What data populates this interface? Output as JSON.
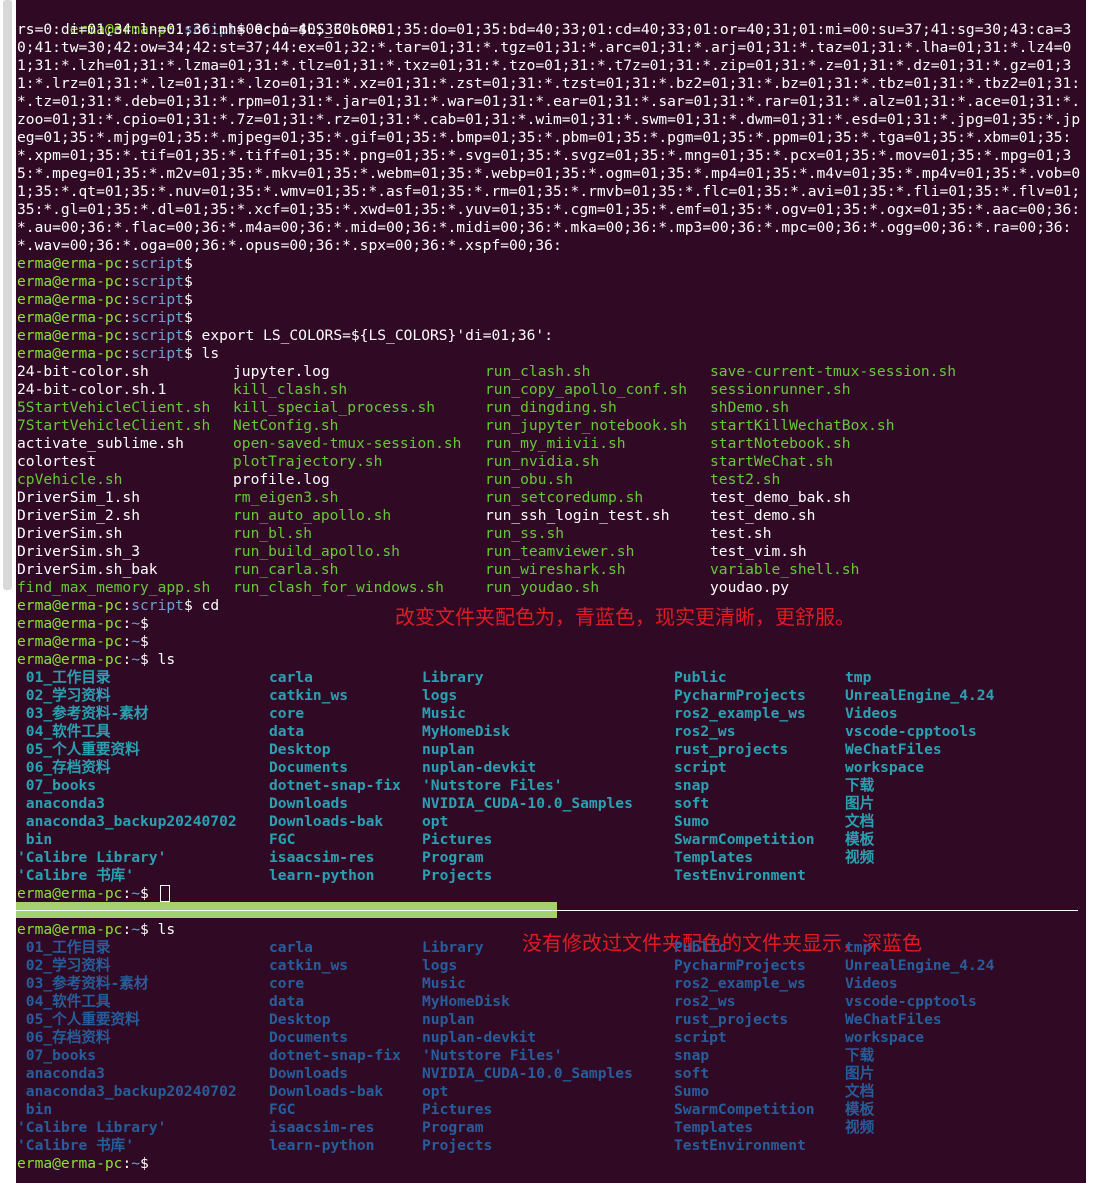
{
  "prompt": {
    "user": "erma@erma-pc",
    "colon": ":",
    "script_dir": "script",
    "home_dir": "~",
    "dollar": "$"
  },
  "commands": {
    "echo": "echo $LS_COLORS",
    "export": "export LS_COLORS=${LS_COLORS}'di=01;36':",
    "ls": "ls",
    "cd": "cd"
  },
  "ls_colors_output": "rs=0:di=01;34:ln=01;36:mh=00:pi=40;33:so=01;35:do=01;35:bd=40;33;01:cd=40;33;01:or=40;31;01:mi=00:su=37;41:sg=30;43:ca=30;41:tw=30;42:ow=34;42:st=37;44:ex=01;32:*.tar=01;31:*.tgz=01;31:*.arc=01;31:*.arj=01;31:*.taz=01;31:*.lha=01;31:*.lz4=01;31:*.lzh=01;31:*.lzma=01;31:*.tlz=01;31:*.txz=01;31:*.tzo=01;31:*.t7z=01;31:*.zip=01;31:*.z=01;31:*.dz=01;31:*.gz=01;31:*.lrz=01;31:*.lz=01;31:*.lzo=01;31:*.xz=01;31:*.zst=01;31:*.tzst=01;31:*.bz2=01;31:*.bz=01;31:*.tbz=01;31:*.tbz2=01;31:*.tz=01;31:*.deb=01;31:*.rpm=01;31:*.jar=01;31:*.war=01;31:*.ear=01;31:*.sar=01;31:*.rar=01;31:*.alz=01;31:*.ace=01;31:*.zoo=01;31:*.cpio=01;31:*.7z=01;31:*.rz=01;31:*.cab=01;31:*.wim=01;31:*.swm=01;31:*.dwm=01;31:*.esd=01;31:*.jpg=01;35:*.jpeg=01;35:*.mjpg=01;35:*.mjpeg=01;35:*.gif=01;35:*.bmp=01;35:*.pbm=01;35:*.pgm=01;35:*.ppm=01;35:*.tga=01;35:*.xbm=01;35:*.xpm=01;35:*.tif=01;35:*.tiff=01;35:*.png=01;35:*.svg=01;35:*.svgz=01;35:*.mng=01;35:*.pcx=01;35:*.mov=01;35:*.mpg=01;35:*.mpeg=01;35:*.m2v=01;35:*.mkv=01;35:*.webm=01;35:*.webp=01;35:*.ogm=01;35:*.mp4=01;35:*.m4v=01;35:*.mp4v=01;35:*.vob=01;35:*.qt=01;35:*.nuv=01;35:*.wmv=01;35:*.asf=01;35:*.rm=01;35:*.rmvb=01;35:*.flc=01;35:*.avi=01;35:*.fli=01;35:*.flv=01;35:*.gl=01;35:*.dl=01;35:*.xcf=01;35:*.xwd=01;35:*.yuv=01;35:*.cgm=01;35:*.emf=01;35:*.ogv=01;35:*.ogx=01;35:*.aac=00;36:*.au=00;36:*.flac=00;36:*.m4a=00;36:*.mid=00;36:*.midi=00;36:*.mka=00;36:*.mp3=00;36:*.mpc=00;36:*.ogg=00;36:*.ra=00;36:*.wav=00;36:*.oga=00;36:*.opus=00;36:*.spx=00;36:*.xspf=00;36:",
  "script_ls": [
    [
      {
        "t": "24-bit-color.sh",
        "c": "w"
      },
      {
        "t": "24-bit-color.sh.1",
        "c": "w"
      },
      {
        "t": "5StartVehicleClient.sh",
        "c": "g"
      },
      {
        "t": "7StartVehicleClient.sh",
        "c": "g"
      },
      {
        "t": "activate_sublime.sh",
        "c": "w"
      },
      {
        "t": "colortest",
        "c": "w"
      },
      {
        "t": "cpVehicle.sh",
        "c": "g"
      },
      {
        "t": "DriverSim_1.sh",
        "c": "w"
      },
      {
        "t": "DriverSim_2.sh",
        "c": "w"
      },
      {
        "t": "DriverSim.sh",
        "c": "w"
      },
      {
        "t": "DriverSim.sh_3",
        "c": "w"
      },
      {
        "t": "DriverSim.sh_bak",
        "c": "w"
      },
      {
        "t": "find_max_memory_app.sh",
        "c": "g"
      }
    ],
    [
      {
        "t": "jupyter.log",
        "c": "w"
      },
      {
        "t": "kill_clash.sh",
        "c": "g"
      },
      {
        "t": "kill_special_process.sh",
        "c": "g"
      },
      {
        "t": "NetConfig.sh",
        "c": "g"
      },
      {
        "t": "open-saved-tmux-session.sh",
        "c": "g"
      },
      {
        "t": "plotTrajectory.sh",
        "c": "g"
      },
      {
        "t": "profile.log",
        "c": "w"
      },
      {
        "t": "rm_eigen3.sh",
        "c": "g"
      },
      {
        "t": "run_auto_apollo.sh",
        "c": "g"
      },
      {
        "t": "run_bl.sh",
        "c": "g"
      },
      {
        "t": "run_build_apollo.sh",
        "c": "g"
      },
      {
        "t": "run_carla.sh",
        "c": "g"
      },
      {
        "t": "run_clash_for_windows.sh",
        "c": "g"
      }
    ],
    [
      {
        "t": "run_clash.sh",
        "c": "g"
      },
      {
        "t": "run_copy_apollo_conf.sh",
        "c": "g"
      },
      {
        "t": "run_dingding.sh",
        "c": "g"
      },
      {
        "t": "run_jupyter_notebook.sh",
        "c": "g"
      },
      {
        "t": "run_my_miivii.sh",
        "c": "g"
      },
      {
        "t": "run_nvidia.sh",
        "c": "g"
      },
      {
        "t": "run_obu.sh",
        "c": "g"
      },
      {
        "t": "run_setcoredump.sh",
        "c": "g"
      },
      {
        "t": "run_ssh_login_test.sh",
        "c": "w"
      },
      {
        "t": "run_ss.sh",
        "c": "g"
      },
      {
        "t": "run_teamviewer.sh",
        "c": "g"
      },
      {
        "t": "run_wireshark.sh",
        "c": "g"
      },
      {
        "t": "run_youdao.sh",
        "c": "g"
      }
    ],
    [
      {
        "t": "save-current-tmux-session.sh",
        "c": "g"
      },
      {
        "t": "sessionrunner.sh",
        "c": "g"
      },
      {
        "t": "shDemo.sh",
        "c": "g"
      },
      {
        "t": "startKillWechatBox.sh",
        "c": "g"
      },
      {
        "t": "startNotebook.sh",
        "c": "g"
      },
      {
        "t": "startWeChat.sh",
        "c": "g"
      },
      {
        "t": "test2.sh",
        "c": "g"
      },
      {
        "t": "test_demo_bak.sh",
        "c": "w"
      },
      {
        "t": "test_demo.sh",
        "c": "w"
      },
      {
        "t": "test.sh",
        "c": "w"
      },
      {
        "t": "test_vim.sh",
        "c": "w"
      },
      {
        "t": "variable_shell.sh",
        "c": "g"
      },
      {
        "t": "youdao.py",
        "c": "w"
      }
    ]
  ],
  "home_ls": [
    [
      " 01_工作目录",
      " 02_学习资料",
      " 03_参考资料-素材",
      " 04_软件工具",
      " 05_个人重要资料",
      " 06_存档资料",
      " 07_books",
      " anaconda3",
      " anaconda3_backup20240702",
      " bin",
      "'Calibre Library'",
      "'Calibre 书库'"
    ],
    [
      "carla",
      "catkin_ws",
      "core",
      "data",
      "Desktop",
      "Documents",
      "dotnet-snap-fix",
      "Downloads",
      "Downloads-bak",
      "FGC",
      "isaacsim-res",
      "learn-python"
    ],
    [
      "Library",
      "logs",
      "Music",
      "MyHomeDisk",
      "nuplan",
      "nuplan-devkit",
      "'Nutstore Files'",
      "NVIDIA_CUDA-10.0_Samples",
      "opt",
      "Pictures",
      "Program",
      "Projects"
    ],
    [
      "Public",
      "PycharmProjects",
      "ros2_example_ws",
      "ros2_ws",
      "rust_projects",
      "script",
      "snap",
      "soft",
      "Sumo",
      "SwarmCompetition",
      "Templates",
      "TestEnvironment"
    ],
    [
      "tmp",
      "UnrealEngine_4.24",
      "Videos",
      "vscode-cpptools",
      "WeChatFiles",
      "workspace",
      "下载",
      "图片",
      "文档",
      "模板",
      "视频"
    ]
  ],
  "notes": {
    "top": "改变文件夹配色为，青蓝色，现实更清晰，更舒服。",
    "bottom": "没有修改过文件夹配色的文件夹显示，深蓝色"
  },
  "colors": {
    "background": "#300a24",
    "prompt_user": "#8ae234",
    "prompt_path": "#729fcf",
    "exec": "#4e9a06",
    "dir_cyan": "#2aa1b3",
    "dir_blue": "#275d9b",
    "note": "#e01b24"
  }
}
